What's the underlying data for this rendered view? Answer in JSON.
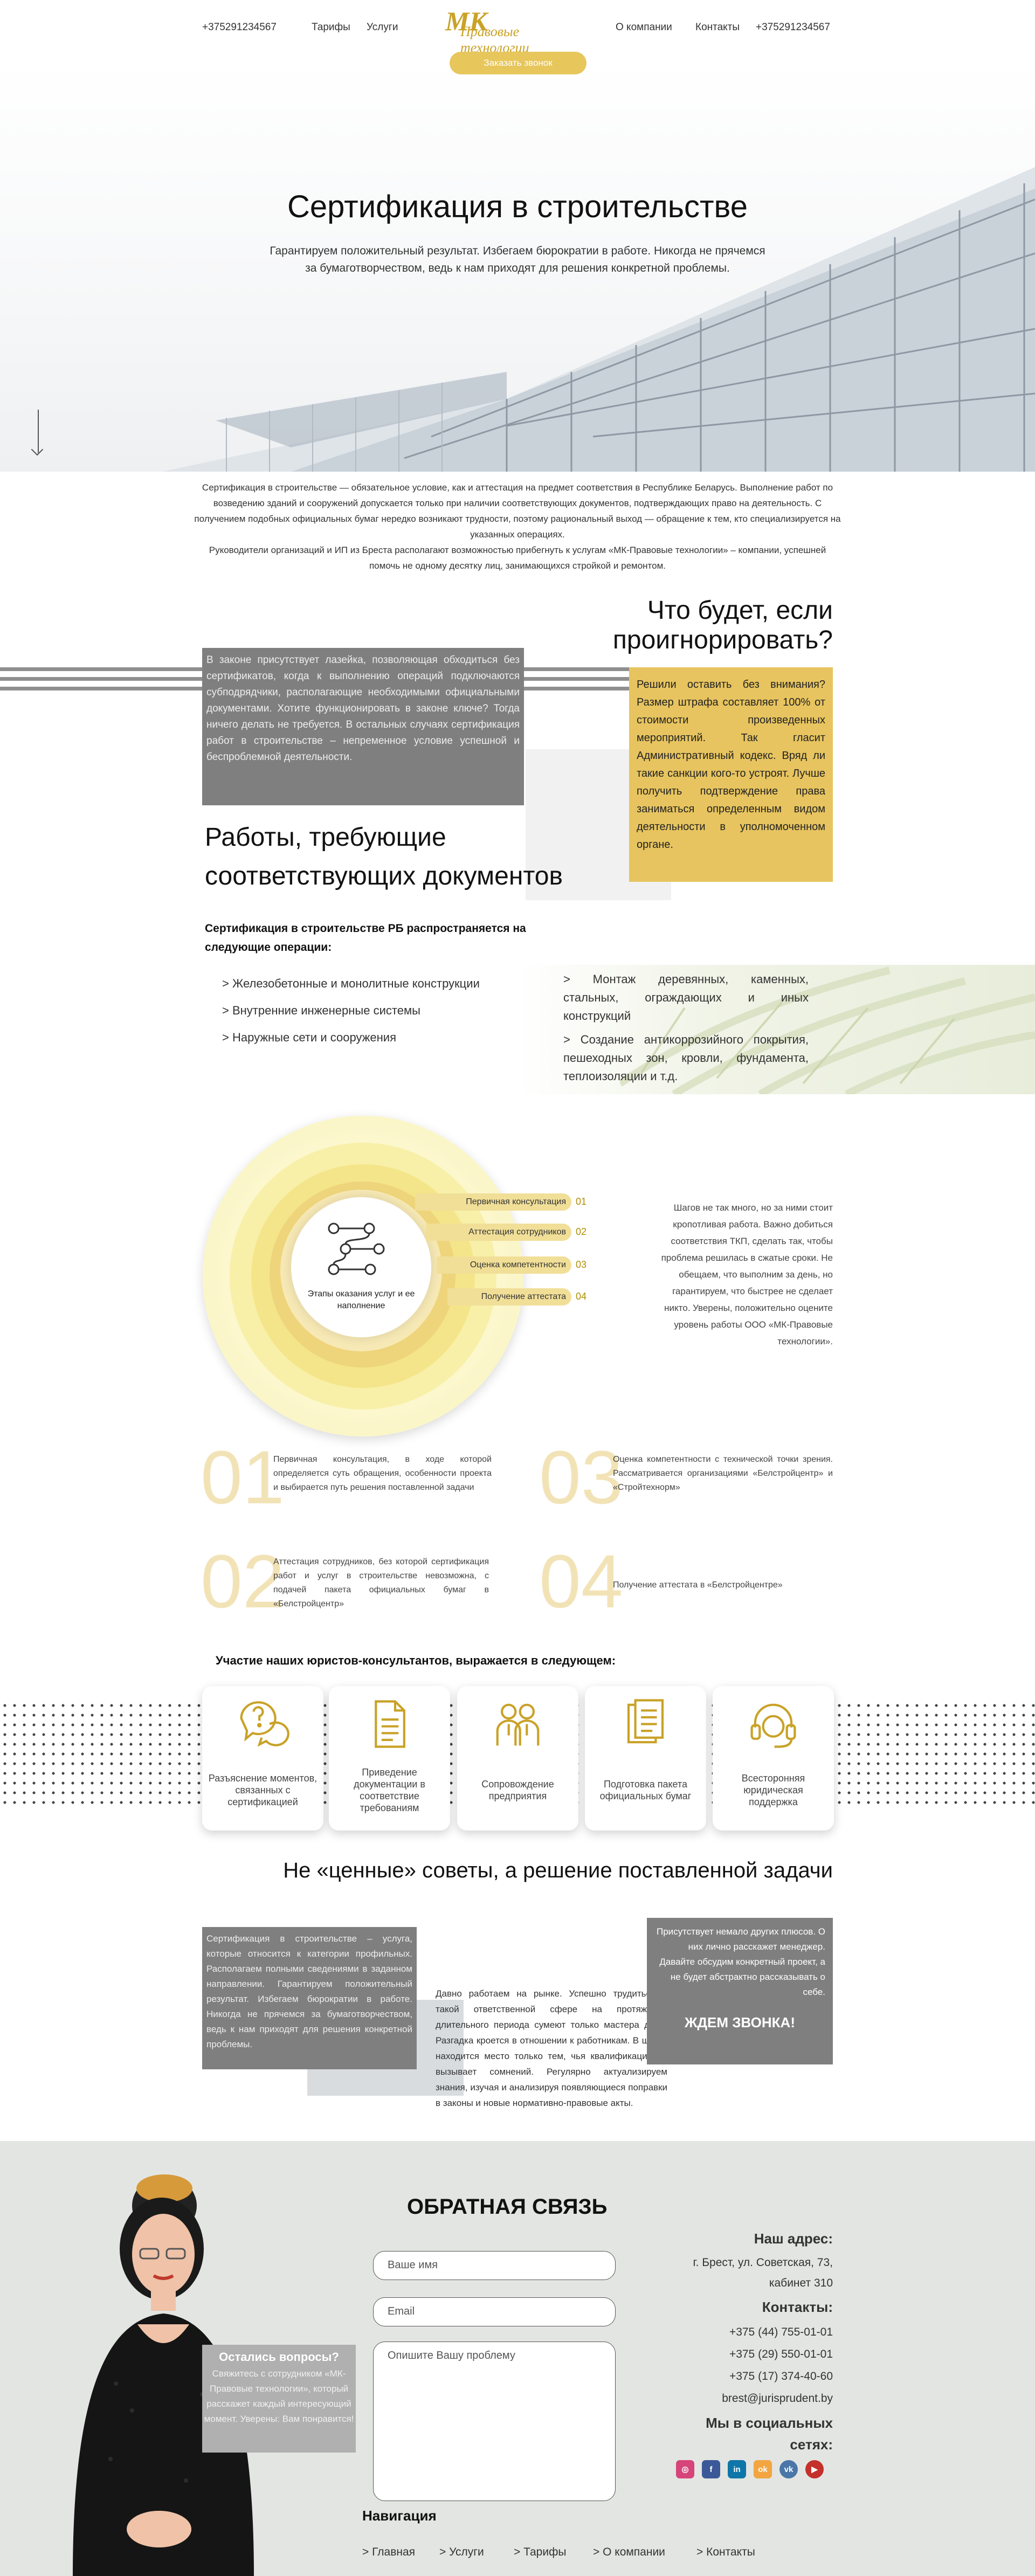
{
  "header": {
    "phone_left": "+375291234567",
    "nav_tariffs": "Тарифы",
    "nav_services": "Услуги",
    "logo_mark": "МК",
    "logo_line1": "МК",
    "logo_line2": "Правовые технологии",
    "nav_about": "О компании",
    "nav_contacts": "Контакты",
    "phone_right": "+375291234567",
    "call_button": "Заказать звонок"
  },
  "hero": {
    "title": "Сертификация в строительстве",
    "subtitle": "Гарантируем положительный результат. Избегаем бюрократии в работе. Никогда не прячемся за бумаготворчеством, ведь к нам приходят для решения конкретной проблемы."
  },
  "intro": {
    "p1": "Сертификация в строительстве — обязательное условие, как и аттестация на предмет соответствия в Республике Беларусь. Выполнение работ по возведению зданий и сооружений допускается только при наличии соответствующих документов, подтверждающих право на деятельность. С получением подобных официальных бумаг нередко возникают трудности, поэтому рациональный выход — обращение к тем, кто специализируется на указанных операциях.",
    "p2": "Руководители организаций и ИП из Бреста располагают возможностью прибегнуть к услугам «МК-Правовые технологии» – компании, успешней помочь не одному десятку лиц, занимающихся стройкой и ремонтом."
  },
  "ignore": {
    "title": "Что будет, если проигнорировать?",
    "gray_text": "В законе присутствует лазейка, позволяющая обходиться без сертификатов, когда к выполнению операций подключаются субподрядчики, располагающие необходимыми официальными документами. Хотите функционировать в законе ключе? Тогда ничего делать не требуется. В остальных случаях сертификация работ в строительстве – непременное условие успешной и беспроблемной деятельности.",
    "gold_text": "Решили оставить без внимания? Размер штрафа составляет 100% от стоимости произведенных мероприятий. Так гласит Административный кодекс. Вряд ли такие санкции кого-то устроят. Лучше получить подтверждение права заниматься определенным видом деятельности в уполномоченном органе."
  },
  "works": {
    "title_line1": "Работы, требующие",
    "title_line2": "соответствующих документов",
    "lead": "Сертификация в строительстве РБ распространяется на следующие операции:",
    "left": [
      "> Железобетонные и монолитные конструкции",
      "> Внутренние инженерные системы",
      "> Наружные сети и сооружения"
    ],
    "right": [
      "> Монтаж деревянных, каменных, стальных, ограждающих и иных конструкций",
      "> Создание антикоррозийного покрытия, пешеходных зон, кровли, фундамента, теплоизоляции и т.д."
    ]
  },
  "stages": {
    "center_label": "Этапы оказания услуг и ее наполнение",
    "steps": [
      {
        "label": "Первичная консультация",
        "num": "01"
      },
      {
        "label": "Аттестация сотрудников",
        "num": "02"
      },
      {
        "label": "Оценка компетентности",
        "num": "03"
      },
      {
        "label": "Получение аттестата",
        "num": "04"
      }
    ],
    "side_text": "Шагов не так много, но за ними стоит кропотливая работа. Важно добиться соответствия ТКП, сделать так, чтобы проблема решилась в сжатые сроки. Не обещаем, что выполним за день, но гарантируем, что быстрее не сделает никто. Уверены, положительно оцените уровень работы ООО «МК-Правовые технологии».",
    "details": [
      {
        "num": "01",
        "text": "Первичная консультация, в ходе которой определяется суть обращения, особенности проекта и выбирается путь решения поставленной задачи"
      },
      {
        "num": "03",
        "text": "Оценка компетентности с технической точки зрения. Рассматривается организациями «Белстройцентр» и «Стройтехнорм»"
      },
      {
        "num": "02",
        "text": "Аттестация сотрудников, без которой сертификация работ и услуг в строительстве невозможна, с подачей пакета официальных бумаг в «Белстройцентр»"
      },
      {
        "num": "04",
        "text": "Получение аттестата в «Белстройцентре»"
      }
    ]
  },
  "participation": {
    "title": "Участие наших юристов-консультантов, выражается в следующем:",
    "cards": [
      {
        "icon": "question-bubbles-icon",
        "text": "Разъяснение моментов, связанных с сертификацией"
      },
      {
        "icon": "document-icon",
        "text": "Приведение документации в соответствие требованиям"
      },
      {
        "icon": "two-people-icon",
        "text": "Сопровождение предприятия"
      },
      {
        "icon": "document-stack-icon",
        "text": "Подготовка пакета официальных бумаг"
      },
      {
        "icon": "headset-icon",
        "text": "Всесторонняя юридическая поддержка"
      }
    ]
  },
  "advice": {
    "title": "Не «ценные» советы, а решение поставленной задачи",
    "gray_text": "Сертификация в строительстве – услуга, которые относится к категории профильных. Располагаем полными сведениями в заданном направлении. Гарантируем положительный результат. Избегаем бюрократии в работе. Никогда не прячемся за бумаготворчеством, ведь к нам приходят для решения конкретной проблемы.",
    "mid_text": "Давно работаем на рынке. Успешно трудиться в такой ответственной сфере на протяжении длительного периода сумеют только мастера дела. Разгадка кроется в отношении к работникам. В штате находится место только тем, чья квалификация не вызывает сомнений. Регулярно актуализируем знания, изучая и анализируя появляющиеся поправки в законы и новые нормативно-правовые акты.",
    "box_text": "Присутствует немало других плюсов. О них лично расскажет менеджер. Давайте обсудим конкретный проект, а не будет абстрактно рассказывать о себе.",
    "box_cta": "ЖДЕМ ЗВОНКА!"
  },
  "footer": {
    "feedback_title": "ОБРАТНАЯ СВЯЗЬ",
    "name_placeholder": "Ваше имя",
    "email_placeholder": "Email",
    "problem_placeholder": "Опишите Вашу проблему",
    "bubble_title": "Остались вопросы?",
    "bubble_text": "Свяжитесь с сотрудником «МК-Правовые технологии», который расскажет каждый интересующий момент. Уверены: Вам понравится!",
    "address_h": "Наш адрес:",
    "address_1": "г. Брест, ул. Советская, 73,",
    "address_2": "кабинет 310",
    "contacts_h": "Контакты:",
    "phone1": "+375 (44) 755-01-01",
    "phone2": "+375 (29) 550-01-01",
    "phone3": "+375 (17) 374-40-60",
    "email": "brest@jurisprudent.by",
    "social_h1": "Мы в социальных",
    "social_h2": "сетях:",
    "social": [
      "instagram-icon",
      "facebook-icon",
      "linkedin-icon",
      "odnoklassniki-icon",
      "vk-icon",
      "youtube-icon"
    ],
    "nav_h": "Навигация",
    "nav": [
      "> Главная",
      "> Услуги",
      "> Тарифы",
      "> О компании",
      "> Контакты"
    ]
  },
  "colors": {
    "gold": "#e7c45f",
    "gray": "#7f7f7f",
    "footer_bg": "#e3e5e2"
  }
}
